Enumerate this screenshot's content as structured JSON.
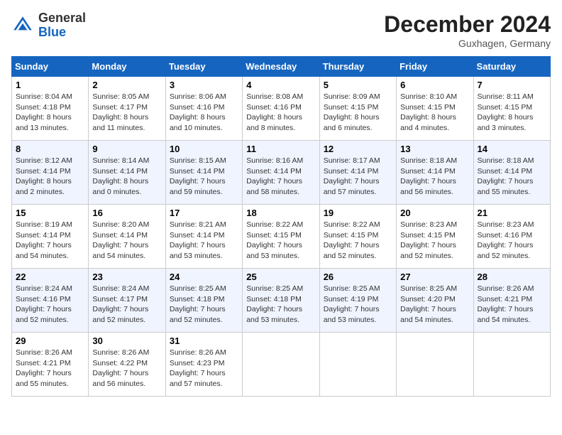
{
  "header": {
    "logo_line1": "General",
    "logo_line2": "Blue",
    "month": "December 2024",
    "location": "Guxhagen, Germany"
  },
  "days_of_week": [
    "Sunday",
    "Monday",
    "Tuesday",
    "Wednesday",
    "Thursday",
    "Friday",
    "Saturday"
  ],
  "weeks": [
    [
      {
        "day": 1,
        "info": "Sunrise: 8:04 AM\nSunset: 4:18 PM\nDaylight: 8 hours and 13 minutes."
      },
      {
        "day": 2,
        "info": "Sunrise: 8:05 AM\nSunset: 4:17 PM\nDaylight: 8 hours and 11 minutes."
      },
      {
        "day": 3,
        "info": "Sunrise: 8:06 AM\nSunset: 4:16 PM\nDaylight: 8 hours and 10 minutes."
      },
      {
        "day": 4,
        "info": "Sunrise: 8:08 AM\nSunset: 4:16 PM\nDaylight: 8 hours and 8 minutes."
      },
      {
        "day": 5,
        "info": "Sunrise: 8:09 AM\nSunset: 4:15 PM\nDaylight: 8 hours and 6 minutes."
      },
      {
        "day": 6,
        "info": "Sunrise: 8:10 AM\nSunset: 4:15 PM\nDaylight: 8 hours and 4 minutes."
      },
      {
        "day": 7,
        "info": "Sunrise: 8:11 AM\nSunset: 4:15 PM\nDaylight: 8 hours and 3 minutes."
      }
    ],
    [
      {
        "day": 8,
        "info": "Sunrise: 8:12 AM\nSunset: 4:14 PM\nDaylight: 8 hours and 2 minutes."
      },
      {
        "day": 9,
        "info": "Sunrise: 8:14 AM\nSunset: 4:14 PM\nDaylight: 8 hours and 0 minutes."
      },
      {
        "day": 10,
        "info": "Sunrise: 8:15 AM\nSunset: 4:14 PM\nDaylight: 7 hours and 59 minutes."
      },
      {
        "day": 11,
        "info": "Sunrise: 8:16 AM\nSunset: 4:14 PM\nDaylight: 7 hours and 58 minutes."
      },
      {
        "day": 12,
        "info": "Sunrise: 8:17 AM\nSunset: 4:14 PM\nDaylight: 7 hours and 57 minutes."
      },
      {
        "day": 13,
        "info": "Sunrise: 8:18 AM\nSunset: 4:14 PM\nDaylight: 7 hours and 56 minutes."
      },
      {
        "day": 14,
        "info": "Sunrise: 8:18 AM\nSunset: 4:14 PM\nDaylight: 7 hours and 55 minutes."
      }
    ],
    [
      {
        "day": 15,
        "info": "Sunrise: 8:19 AM\nSunset: 4:14 PM\nDaylight: 7 hours and 54 minutes."
      },
      {
        "day": 16,
        "info": "Sunrise: 8:20 AM\nSunset: 4:14 PM\nDaylight: 7 hours and 54 minutes."
      },
      {
        "day": 17,
        "info": "Sunrise: 8:21 AM\nSunset: 4:14 PM\nDaylight: 7 hours and 53 minutes."
      },
      {
        "day": 18,
        "info": "Sunrise: 8:22 AM\nSunset: 4:15 PM\nDaylight: 7 hours and 53 minutes."
      },
      {
        "day": 19,
        "info": "Sunrise: 8:22 AM\nSunset: 4:15 PM\nDaylight: 7 hours and 52 minutes."
      },
      {
        "day": 20,
        "info": "Sunrise: 8:23 AM\nSunset: 4:15 PM\nDaylight: 7 hours and 52 minutes."
      },
      {
        "day": 21,
        "info": "Sunrise: 8:23 AM\nSunset: 4:16 PM\nDaylight: 7 hours and 52 minutes."
      }
    ],
    [
      {
        "day": 22,
        "info": "Sunrise: 8:24 AM\nSunset: 4:16 PM\nDaylight: 7 hours and 52 minutes."
      },
      {
        "day": 23,
        "info": "Sunrise: 8:24 AM\nSunset: 4:17 PM\nDaylight: 7 hours and 52 minutes."
      },
      {
        "day": 24,
        "info": "Sunrise: 8:25 AM\nSunset: 4:18 PM\nDaylight: 7 hours and 52 minutes."
      },
      {
        "day": 25,
        "info": "Sunrise: 8:25 AM\nSunset: 4:18 PM\nDaylight: 7 hours and 53 minutes."
      },
      {
        "day": 26,
        "info": "Sunrise: 8:25 AM\nSunset: 4:19 PM\nDaylight: 7 hours and 53 minutes."
      },
      {
        "day": 27,
        "info": "Sunrise: 8:25 AM\nSunset: 4:20 PM\nDaylight: 7 hours and 54 minutes."
      },
      {
        "day": 28,
        "info": "Sunrise: 8:26 AM\nSunset: 4:21 PM\nDaylight: 7 hours and 54 minutes."
      }
    ],
    [
      {
        "day": 29,
        "info": "Sunrise: 8:26 AM\nSunset: 4:21 PM\nDaylight: 7 hours and 55 minutes."
      },
      {
        "day": 30,
        "info": "Sunrise: 8:26 AM\nSunset: 4:22 PM\nDaylight: 7 hours and 56 minutes."
      },
      {
        "day": 31,
        "info": "Sunrise: 8:26 AM\nSunset: 4:23 PM\nDaylight: 7 hours and 57 minutes."
      },
      null,
      null,
      null,
      null
    ]
  ]
}
